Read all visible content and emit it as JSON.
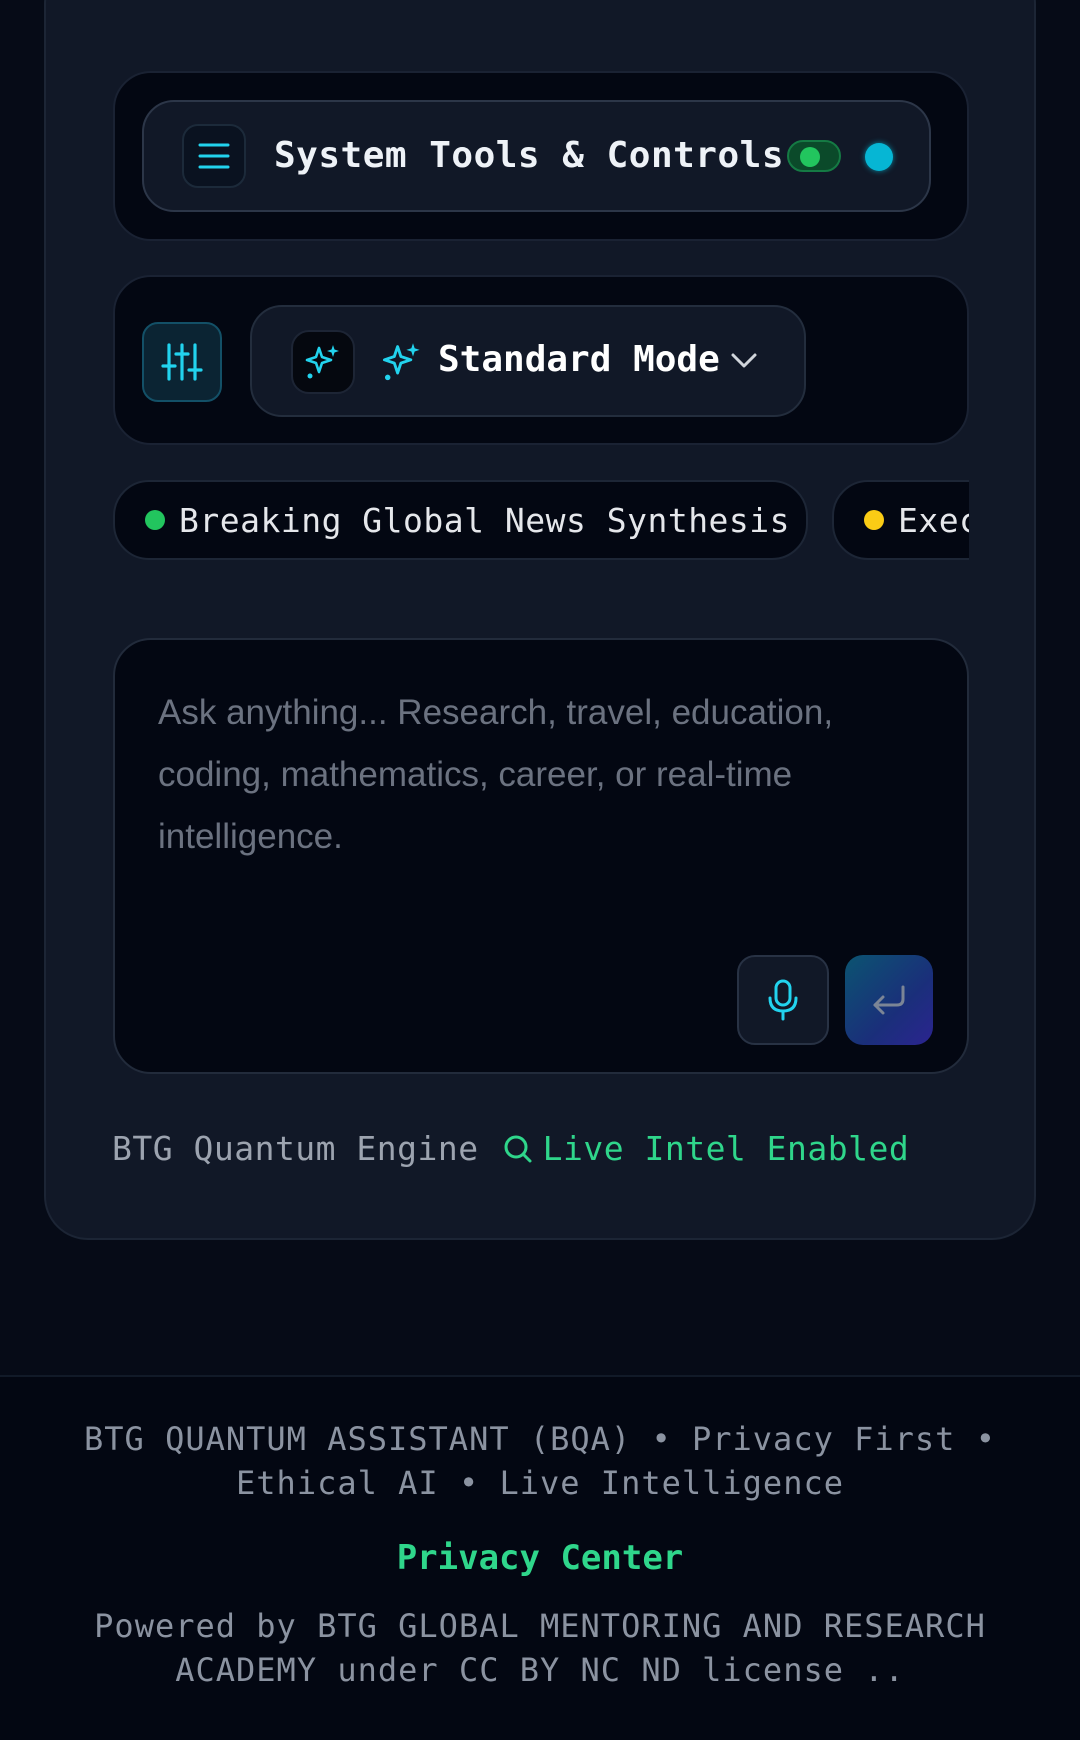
{
  "tools": {
    "title": "System Tools & Controls",
    "toggle_on": true
  },
  "mode": {
    "label": "Standard Mode"
  },
  "chips": [
    {
      "label": "Breaking Global News Synthesis",
      "dot_color": "#22c55e"
    },
    {
      "label": "Exec",
      "dot_color": "#facc15"
    }
  ],
  "input": {
    "placeholder": "Ask anything... Research, travel, education, coding, mathematics, career, or real-time intelligence."
  },
  "engine": {
    "name": "BTG Quantum Engine",
    "live_label": "Live Intel Enabled"
  },
  "footer": {
    "line1": "BTG QUANTUM ASSISTANT (BQA) • Privacy First •",
    "line2": "Ethical AI • Live Intelligence",
    "privacy_link": "Privacy Center",
    "powered1": "Powered by BTG GLOBAL MENTORING AND RESEARCH",
    "powered2": "ACADEMY under CC BY NC ND license .."
  },
  "colors": {
    "accent_cyan": "#06b6d4",
    "accent_green": "#2fd68b",
    "background": "#060b17"
  },
  "icons": {
    "menu": "menu-icon",
    "sliders": "sliders-icon",
    "sparkle": "sparkles-icon",
    "chevron": "chevron-down-icon",
    "mic": "microphone-icon",
    "send": "enter-icon",
    "search": "search-icon"
  }
}
